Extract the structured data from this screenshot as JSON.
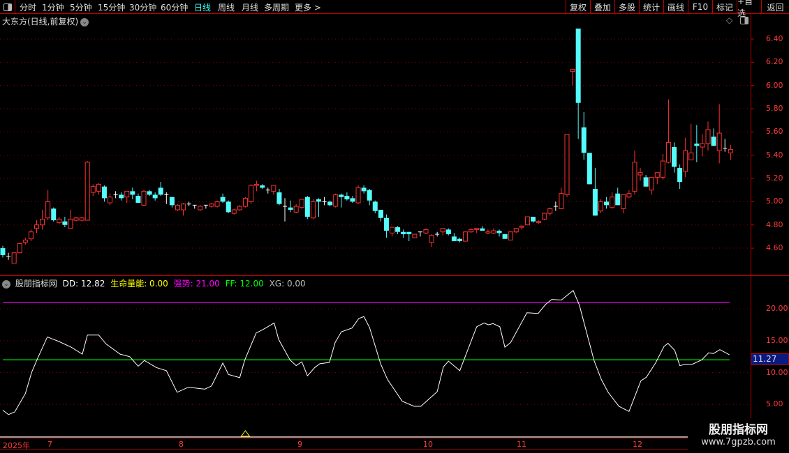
{
  "topbar": {
    "tabs": [
      "分时",
      "1分钟",
      "5分钟",
      "15分钟",
      "30分钟",
      "60分钟",
      "日线",
      "周线",
      "月线",
      "多周期",
      "更多 >"
    ],
    "active_tab": "日线",
    "buttons": [
      "复权",
      "叠加",
      "多股",
      "统计",
      "画线",
      "F10",
      "标记",
      "+自选",
      "返回"
    ]
  },
  "main": {
    "title": "大东方(日线,前复权)",
    "y_labels": [
      "6.40",
      "6.20",
      "6.00",
      "5.80",
      "5.60",
      "5.40",
      "5.20",
      "5.00",
      "4.80",
      "4.60"
    ]
  },
  "indicator": {
    "name": "股朋指标网",
    "dd_label": "DD: 12.82",
    "life_label": "生命量能: 0.00",
    "strong_label": "强势: 21.00",
    "ff_label": "FF: 12.00",
    "xg_label": "XG: 0.00",
    "y_labels": [
      "20.00",
      "15.00",
      "10.00",
      "5.00"
    ],
    "current_value": "11.27"
  },
  "date_axis": {
    "labels": [
      "2025年",
      "7",
      "8",
      "9",
      "10",
      "11",
      "12"
    ]
  },
  "watermark": {
    "line1": "股朋指标网",
    "line2": "www.7gpzb.com"
  },
  "colors": {
    "up": "#ff3232",
    "down": "#54fcfc",
    "doji": "#ffffff",
    "strong": "#ff00ff",
    "ff": "#00ff00",
    "dd": "#ffffff",
    "xg": "#ffff00"
  },
  "chart_data": [
    {
      "type": "candlestick",
      "title": "大东方(日线,前复权)",
      "ylim": [
        4.45,
        6.55
      ],
      "ohlc": [
        [
          4.6,
          4.62,
          4.52,
          4.54
        ],
        [
          4.53,
          4.56,
          4.5,
          4.53
        ],
        [
          4.47,
          4.56,
          4.47,
          4.56
        ],
        [
          4.56,
          4.64,
          4.56,
          4.64
        ],
        [
          4.65,
          4.69,
          4.63,
          4.67
        ],
        [
          4.68,
          4.76,
          4.66,
          4.74
        ],
        [
          4.77,
          4.84,
          4.73,
          4.8
        ],
        [
          4.8,
          4.93,
          4.76,
          4.85
        ],
        [
          4.86,
          5.1,
          4.84,
          5.0
        ],
        [
          4.94,
          4.95,
          4.83,
          4.84
        ],
        [
          4.82,
          4.87,
          4.81,
          4.85
        ],
        [
          4.83,
          4.87,
          4.78,
          4.8
        ],
        [
          4.77,
          4.93,
          4.77,
          4.85
        ],
        [
          4.84,
          4.87,
          4.83,
          4.86
        ],
        [
          4.84,
          4.87,
          4.83,
          4.86
        ],
        [
          4.84,
          5.35,
          4.84,
          5.34
        ],
        [
          5.08,
          5.15,
          5.05,
          5.13
        ],
        [
          5.09,
          5.16,
          5.06,
          5.15
        ],
        [
          5.13,
          5.14,
          5.0,
          5.03
        ],
        [
          4.99,
          5.07,
          4.97,
          5.04
        ],
        [
          5.06,
          5.09,
          5.03,
          5.06
        ],
        [
          5.06,
          5.08,
          5.01,
          5.03
        ],
        [
          5.04,
          5.09,
          4.99,
          5.09
        ],
        [
          5.09,
          5.12,
          5.02,
          5.06
        ],
        [
          5.05,
          5.07,
          4.99,
          4.99
        ],
        [
          4.97,
          5.1,
          4.96,
          5.09
        ],
        [
          5.09,
          5.1,
          5.05,
          5.06
        ],
        [
          5.06,
          5.08,
          5.01,
          5.03
        ],
        [
          5.12,
          5.17,
          5.05,
          5.06
        ],
        [
          5.06,
          5.08,
          4.98,
          5.06
        ],
        [
          5.04,
          5.04,
          4.95,
          4.97
        ],
        [
          4.93,
          4.98,
          4.92,
          4.97
        ],
        [
          4.93,
          4.99,
          4.88,
          4.98
        ],
        [
          4.98,
          5.0,
          4.96,
          4.98
        ],
        [
          4.97,
          4.97,
          4.94,
          4.97
        ],
        [
          4.93,
          4.97,
          4.92,
          4.96
        ],
        [
          4.97,
          4.97,
          4.94,
          4.97
        ],
        [
          4.96,
          4.99,
          4.95,
          4.98
        ],
        [
          4.96,
          5.01,
          4.95,
          5.0
        ],
        [
          5.04,
          5.07,
          4.99,
          5.0
        ],
        [
          5.0,
          5.01,
          4.9,
          4.91
        ],
        [
          4.9,
          4.94,
          4.89,
          4.93
        ],
        [
          4.93,
          4.97,
          4.92,
          4.96
        ],
        [
          4.96,
          5.04,
          4.95,
          5.03
        ],
        [
          5.0,
          5.15,
          4.98,
          5.14
        ],
        [
          5.14,
          5.18,
          5.09,
          5.15
        ],
        [
          5.14,
          5.15,
          5.11,
          5.12
        ],
        [
          5.1,
          5.12,
          5.07,
          5.1
        ],
        [
          5.09,
          5.14,
          5.06,
          5.14
        ],
        [
          5.08,
          5.11,
          4.97,
          4.98
        ],
        [
          4.96,
          5.03,
          4.83,
          4.96
        ],
        [
          4.95,
          5.01,
          4.91,
          4.93
        ],
        [
          4.91,
          4.98,
          4.9,
          4.96
        ],
        [
          4.95,
          5.02,
          4.94,
          5.02
        ],
        [
          5.04,
          5.05,
          4.85,
          4.87
        ],
        [
          4.86,
          5.02,
          4.85,
          5.0
        ],
        [
          5.02,
          5.03,
          4.87,
          5.0
        ],
        [
          5.0,
          5.04,
          4.97,
          5.0
        ],
        [
          5.0,
          5.01,
          4.96,
          4.97
        ],
        [
          4.96,
          5.07,
          4.95,
          5.06
        ],
        [
          5.06,
          5.07,
          4.95,
          5.04
        ],
        [
          5.05,
          5.08,
          5.01,
          5.02
        ],
        [
          5.03,
          5.05,
          4.99,
          5.0
        ],
        [
          4.99,
          5.14,
          4.98,
          5.12
        ],
        [
          5.12,
          5.14,
          5.07,
          5.09
        ],
        [
          5.1,
          5.11,
          4.97,
          5.01
        ],
        [
          5.0,
          5.01,
          4.9,
          4.92
        ],
        [
          4.93,
          4.93,
          4.83,
          4.86
        ],
        [
          4.86,
          4.89,
          4.69,
          4.75
        ],
        [
          4.73,
          4.78,
          4.7,
          4.78
        ],
        [
          4.78,
          4.79,
          4.72,
          4.74
        ],
        [
          4.74,
          4.76,
          4.69,
          4.72
        ],
        [
          4.74,
          4.74,
          4.66,
          4.72
        ],
        [
          4.69,
          4.72,
          4.69,
          4.72
        ],
        [
          4.74,
          4.74,
          4.7,
          4.74
        ],
        [
          4.73,
          4.77,
          4.72,
          4.76
        ],
        [
          4.65,
          4.72,
          4.61,
          4.71
        ],
        [
          4.72,
          4.74,
          4.7,
          4.72
        ],
        [
          4.74,
          4.77,
          4.71,
          4.77
        ],
        [
          4.76,
          4.77,
          4.71,
          4.72
        ],
        [
          4.7,
          4.73,
          4.66,
          4.66
        ],
        [
          4.68,
          4.69,
          4.65,
          4.66
        ],
        [
          4.66,
          4.74,
          4.66,
          4.74
        ],
        [
          4.74,
          4.77,
          4.73,
          4.76
        ],
        [
          4.76,
          4.77,
          4.73,
          4.77
        ],
        [
          4.77,
          4.79,
          4.75,
          4.75
        ],
        [
          4.73,
          4.76,
          4.72,
          4.74
        ],
        [
          4.73,
          4.77,
          4.72,
          4.75
        ],
        [
          4.75,
          4.76,
          4.7,
          4.73
        ],
        [
          4.72,
          4.72,
          4.68,
          4.68
        ],
        [
          4.67,
          4.74,
          4.67,
          4.74
        ],
        [
          4.74,
          4.77,
          4.73,
          4.77
        ],
        [
          4.78,
          4.8,
          4.76,
          4.79
        ],
        [
          4.8,
          4.87,
          4.8,
          4.87
        ],
        [
          4.87,
          4.87,
          4.82,
          4.83
        ],
        [
          4.82,
          4.84,
          4.81,
          4.83
        ],
        [
          4.85,
          4.9,
          4.84,
          4.9
        ],
        [
          4.9,
          4.95,
          4.88,
          4.94
        ],
        [
          4.96,
          5.0,
          4.92,
          4.96
        ],
        [
          4.94,
          5.12,
          4.94,
          5.07
        ],
        [
          5.06,
          5.58,
          5.04,
          5.58
        ],
        [
          6.12,
          6.14,
          6.0,
          6.14
        ],
        [
          6.49,
          6.49,
          5.54,
          5.85
        ],
        [
          5.64,
          5.77,
          5.36,
          5.42
        ],
        [
          5.42,
          5.42,
          5.15,
          5.15
        ],
        [
          5.11,
          5.29,
          4.88,
          4.88
        ],
        [
          4.92,
          5.02,
          4.9,
          5.0
        ],
        [
          5.0,
          5.04,
          4.94,
          4.97
        ],
        [
          4.95,
          5.08,
          4.94,
          5.04
        ],
        [
          5.07,
          5.12,
          4.97,
          4.97
        ],
        [
          4.94,
          5.06,
          4.9,
          5.06
        ],
        [
          5.04,
          5.1,
          5.03,
          5.07
        ],
        [
          5.09,
          5.44,
          5.06,
          5.34
        ],
        [
          5.23,
          5.29,
          5.18,
          5.25
        ],
        [
          5.21,
          5.23,
          5.13,
          5.13
        ],
        [
          5.1,
          5.21,
          5.06,
          5.21
        ],
        [
          5.21,
          5.25,
          5.15,
          5.25
        ],
        [
          5.21,
          5.41,
          5.19,
          5.35
        ],
        [
          5.34,
          5.88,
          5.33,
          5.51
        ],
        [
          5.47,
          5.51,
          5.25,
          5.3
        ],
        [
          5.29,
          5.32,
          5.11,
          5.17
        ],
        [
          5.26,
          5.55,
          5.21,
          5.44
        ],
        [
          5.36,
          5.67,
          5.36,
          5.42
        ],
        [
          5.5,
          5.66,
          5.34,
          5.48
        ],
        [
          5.47,
          5.58,
          5.39,
          5.5
        ],
        [
          5.5,
          5.69,
          5.44,
          5.62
        ],
        [
          5.56,
          5.63,
          5.48,
          5.48
        ],
        [
          5.44,
          5.84,
          5.33,
          5.59
        ],
        [
          5.46,
          5.54,
          5.43,
          5.46
        ],
        [
          5.42,
          5.49,
          5.36,
          5.45
        ]
      ]
    },
    {
      "type": "line",
      "title": "股朋指标网",
      "ylim": [
        3,
        24
      ],
      "hlines": {
        "strong": 21.0,
        "ff": 12.0
      },
      "dd_points": [
        [
          0,
          4.1
        ],
        [
          1,
          3.4
        ],
        [
          2.1,
          3.8
        ],
        [
          4,
          6.7
        ],
        [
          5.1,
          10.0
        ],
        [
          6.1,
          12.1
        ],
        [
          7.9,
          15.6
        ],
        [
          9.9,
          14.9
        ],
        [
          12.1,
          14.0
        ],
        [
          14.1,
          12.9
        ],
        [
          15,
          15.9
        ],
        [
          17,
          15.9
        ],
        [
          18.3,
          14.5
        ],
        [
          20.8,
          12.9
        ],
        [
          22.5,
          12.5
        ],
        [
          24,
          11.0
        ],
        [
          25.1,
          11.9
        ],
        [
          27.2,
          10.8
        ],
        [
          29,
          10.3
        ],
        [
          30.9,
          6.9
        ],
        [
          32.9,
          7.7
        ],
        [
          35.8,
          7.4
        ],
        [
          37,
          7.9
        ],
        [
          39,
          11.5
        ],
        [
          40,
          9.7
        ],
        [
          42,
          9.2
        ],
        [
          42.9,
          12.0
        ],
        [
          44.9,
          16.2
        ],
        [
          46.4,
          16.9
        ],
        [
          48.1,
          17.8
        ],
        [
          48.9,
          15.2
        ],
        [
          50.9,
          12.0
        ],
        [
          52,
          11.1
        ],
        [
          53,
          11.7
        ],
        [
          54,
          9.5
        ],
        [
          55.3,
          10.8
        ],
        [
          56.2,
          11.4
        ],
        [
          57.9,
          11.6
        ],
        [
          58.9,
          14.7
        ],
        [
          60,
          16.4
        ],
        [
          61.9,
          17.0
        ],
        [
          63.1,
          18.5
        ],
        [
          64,
          18.8
        ],
        [
          65,
          17.1
        ],
        [
          67,
          11.3
        ],
        [
          68.2,
          8.9
        ],
        [
          70.8,
          5.5
        ],
        [
          72.9,
          4.7
        ],
        [
          74.1,
          4.7
        ],
        [
          77,
          7.0
        ],
        [
          78.1,
          10.9
        ],
        [
          79,
          11.8
        ],
        [
          81,
          10.3
        ],
        [
          84,
          17.2
        ],
        [
          85.3,
          17.8
        ],
        [
          86.1,
          17.5
        ],
        [
          86.9,
          17.7
        ],
        [
          88.1,
          17.2
        ],
        [
          89,
          14.0
        ],
        [
          90,
          14.7
        ],
        [
          92.9,
          19.4
        ],
        [
          94.9,
          19.3
        ],
        [
          96.2,
          20.7
        ],
        [
          97.3,
          21.5
        ],
        [
          99,
          21.4
        ],
        [
          101.1,
          22.9
        ],
        [
          102.2,
          20.6
        ],
        [
          104.8,
          11.9
        ],
        [
          106.1,
          8.9
        ],
        [
          107.3,
          6.9
        ],
        [
          109.2,
          4.7
        ],
        [
          111,
          3.9
        ],
        [
          113.1,
          8.7
        ],
        [
          114.1,
          9.3
        ],
        [
          115.7,
          11.5
        ],
        [
          117.2,
          14.1
        ],
        [
          117.9,
          14.6
        ],
        [
          119.1,
          13.5
        ],
        [
          120,
          11.1
        ],
        [
          121,
          11.3
        ],
        [
          122.2,
          11.3
        ],
        [
          123.9,
          12.0
        ],
        [
          125.1,
          13.1
        ],
        [
          126,
          13.0
        ],
        [
          127.1,
          13.6
        ],
        [
          128.8,
          12.8
        ]
      ],
      "xg_signal_bars": [
        43
      ]
    }
  ]
}
